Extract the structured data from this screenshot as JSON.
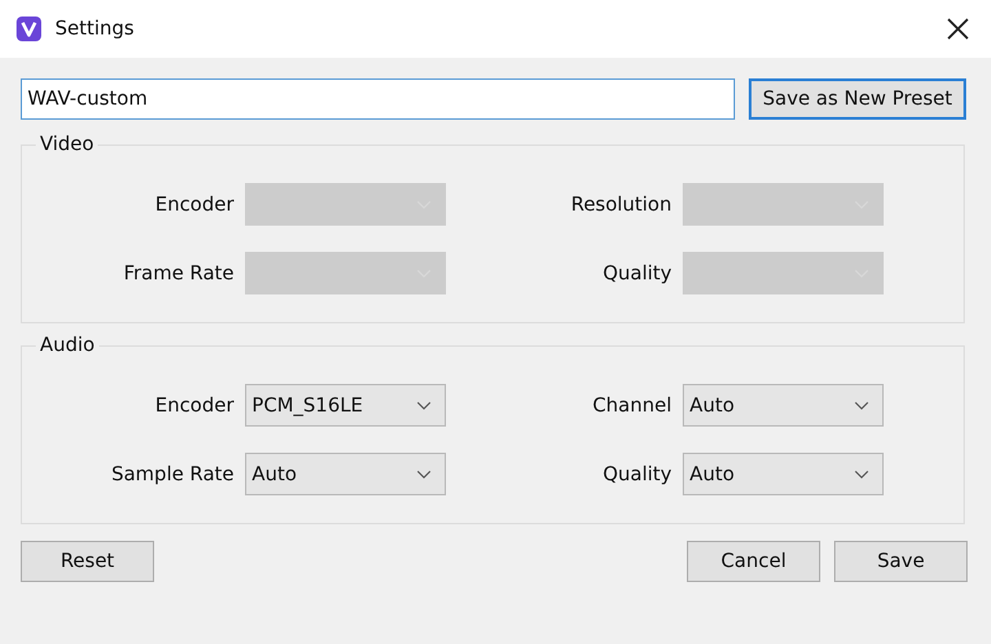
{
  "window": {
    "title": "Settings"
  },
  "preset": {
    "value": "WAV-custom",
    "button": "Save as New Preset"
  },
  "groups": [
    {
      "title": "Video",
      "fields": [
        {
          "label": "Encoder",
          "disabled": true
        },
        {
          "label": "Resolution",
          "disabled": true
        },
        {
          "label": "Frame Rate",
          "disabled": true
        },
        {
          "label": "Quality",
          "disabled": true
        }
      ]
    },
    {
      "title": "Audio",
      "fields": [
        {
          "label": "Encoder",
          "value": "PCM_S16LE",
          "disabled": false
        },
        {
          "label": "Channel",
          "value": "Auto",
          "disabled": false
        },
        {
          "label": "Sample Rate",
          "value": "Auto",
          "disabled": false
        },
        {
          "label": "Quality",
          "value": "Auto",
          "disabled": false
        }
      ]
    }
  ],
  "buttons": {
    "reset": "Reset",
    "cancel": "Cancel",
    "save": "Save"
  }
}
